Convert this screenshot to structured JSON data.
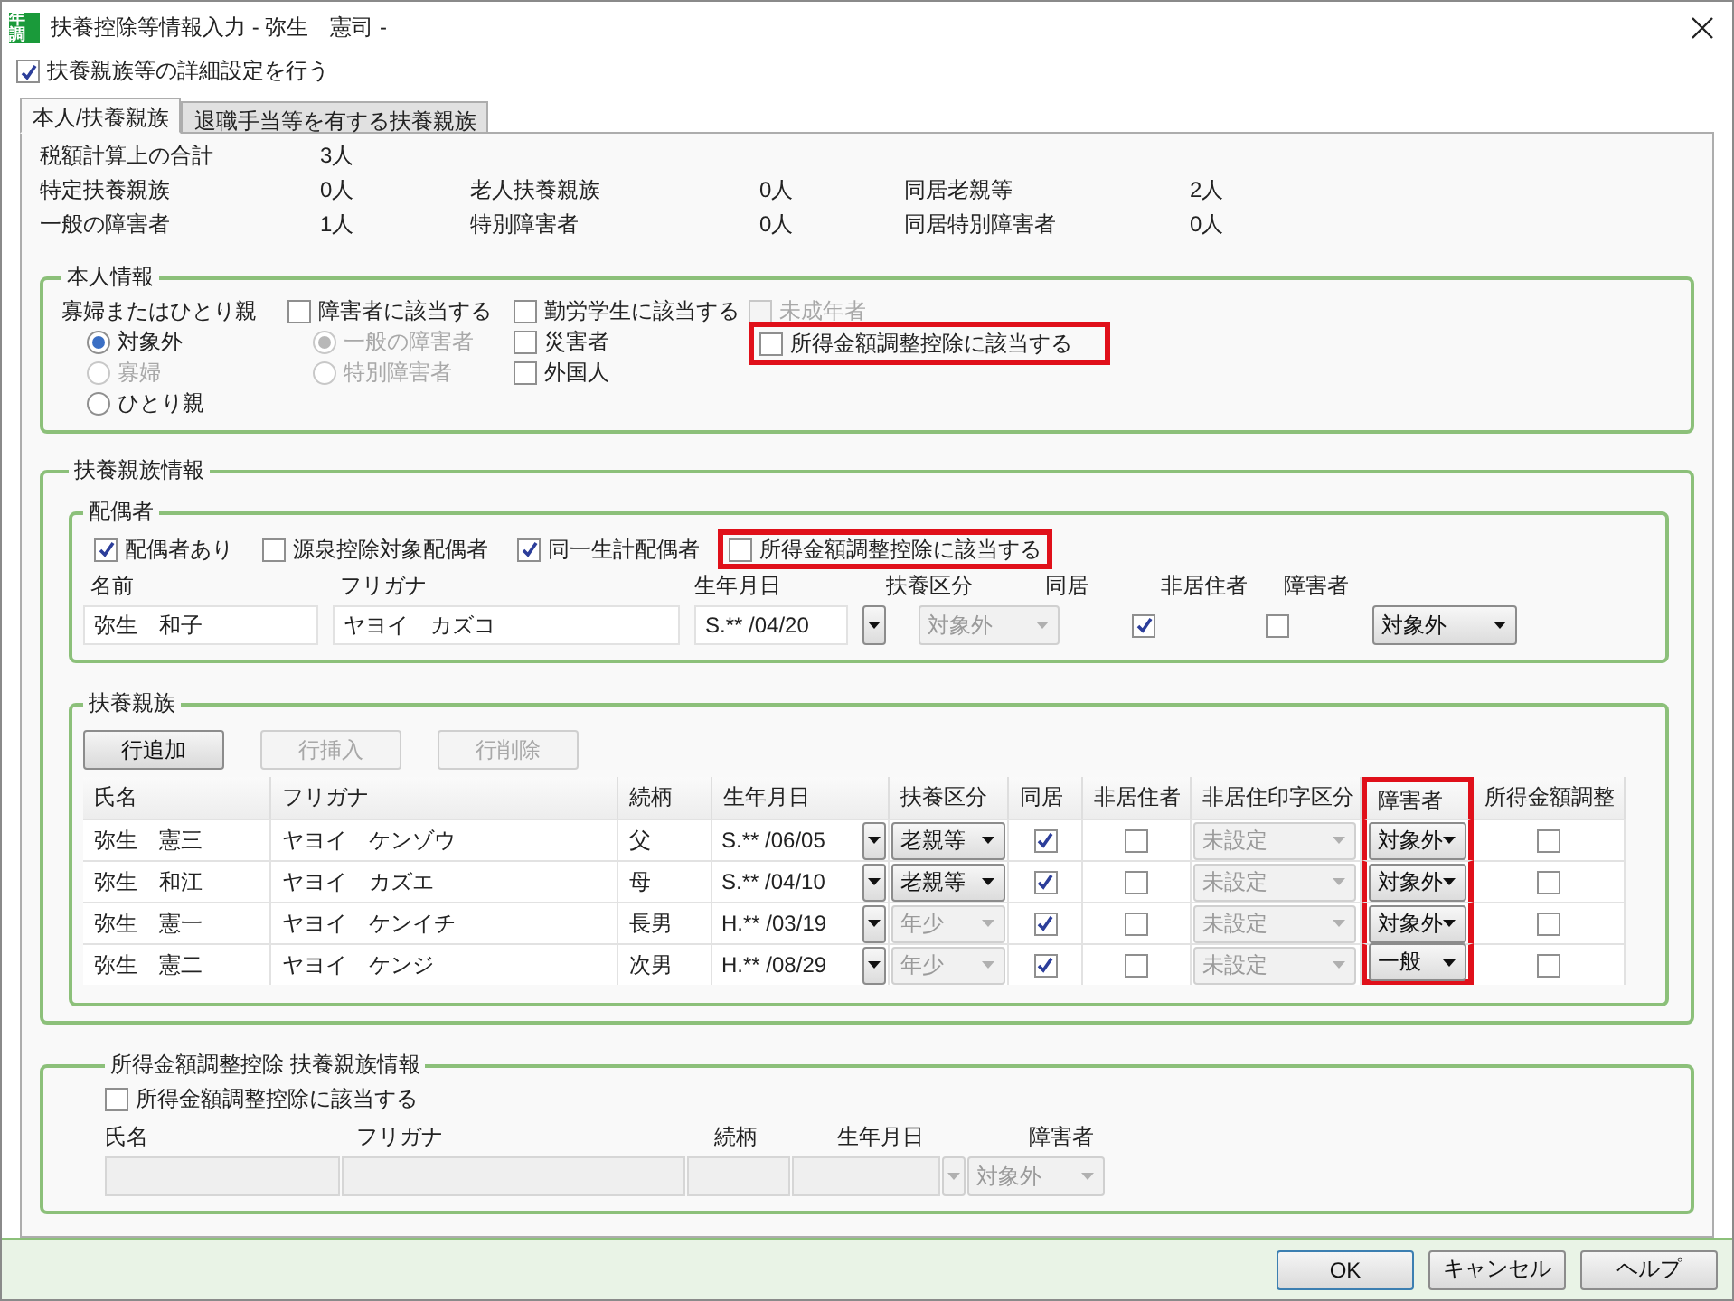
{
  "window": {
    "icon_text": "年調",
    "title": "扶養控除等情報入力 - 弥生　憲司 -"
  },
  "detail_setting": {
    "label": "扶養親族等の詳細設定を行う",
    "checked": true
  },
  "tabs": [
    {
      "label": "本人/扶養親族",
      "selected": true
    },
    {
      "label": "退職手当等を有する扶養親族",
      "selected": false
    }
  ],
  "summary": [
    [
      {
        "label": "税額計算上の合計",
        "value": "3人"
      }
    ],
    [
      {
        "label": "特定扶養親族",
        "value": "0人"
      },
      {
        "label": "老人扶養親族",
        "value": "0人"
      },
      {
        "label": "同居老親等",
        "value": "2人"
      }
    ],
    [
      {
        "label": "一般の障害者",
        "value": "1人"
      },
      {
        "label": "特別障害者",
        "value": "0人"
      },
      {
        "label": "同居特別障害者",
        "value": "0人"
      }
    ]
  ],
  "self_info": {
    "title": "本人情報",
    "widow": {
      "label": "寡婦またはひとり親",
      "options": [
        {
          "label": "対象外",
          "selected": true,
          "disabled": false
        },
        {
          "label": "寡婦",
          "selected": false,
          "disabled": true
        },
        {
          "label": "ひとり親",
          "selected": false,
          "disabled": false
        }
      ]
    },
    "disability": {
      "label": "障害者に該当する",
      "checked": false,
      "options": [
        {
          "label": "一般の障害者",
          "selected": true,
          "disabled": true
        },
        {
          "label": "特別障害者",
          "selected": false,
          "disabled": true
        }
      ]
    },
    "checks": [
      [
        {
          "label": "勤労学生に該当する",
          "checked": false,
          "disabled": false,
          "highlighted": false
        },
        {
          "label": "災害者",
          "checked": false,
          "disabled": false,
          "highlighted": false
        },
        {
          "label": "外国人",
          "checked": false,
          "disabled": false,
          "highlighted": false
        }
      ],
      [
        {
          "label": "未成年者",
          "checked": false,
          "disabled": true,
          "highlighted": false
        },
        {
          "label": "所得金額調整控除に該当する",
          "checked": false,
          "disabled": false,
          "highlighted": true
        }
      ]
    ]
  },
  "dependents_info": {
    "title": "扶養親族情報",
    "spouse": {
      "title": "配偶者",
      "checks": [
        {
          "label": "配偶者あり",
          "checked": true,
          "highlighted": false
        },
        {
          "label": "源泉控除対象配偶者",
          "checked": false,
          "highlighted": false
        },
        {
          "label": "同一生計配偶者",
          "checked": true,
          "highlighted": false
        },
        {
          "label": "所得金額調整控除に該当する",
          "checked": false,
          "highlighted": true
        }
      ],
      "columns": [
        "名前",
        "フリガナ",
        "生年月日",
        "扶養区分",
        "同居",
        "非居住者",
        "障害者"
      ],
      "row": {
        "name": "弥生　和子",
        "kana": "ヤヨイ　カズコ",
        "birth": "S.** /04/20",
        "category": "対象外",
        "category_disabled": true,
        "cohabit": true,
        "nonresident": false,
        "disability": "対象外"
      }
    },
    "family": {
      "title": "扶養親族",
      "buttons": [
        {
          "label": "行追加",
          "disabled": false
        },
        {
          "label": "行挿入",
          "disabled": true
        },
        {
          "label": "行削除",
          "disabled": true
        }
      ],
      "columns": [
        {
          "label": "氏名",
          "highlighted": false
        },
        {
          "label": "フリガナ",
          "highlighted": false
        },
        {
          "label": "続柄",
          "highlighted": false
        },
        {
          "label": "生年月日",
          "highlighted": false
        },
        {
          "label": "扶養区分",
          "highlighted": false
        },
        {
          "label": "同居",
          "highlighted": false
        },
        {
          "label": "非居住者",
          "highlighted": false
        },
        {
          "label": "非居住印字区分",
          "highlighted": false
        },
        {
          "label": "障害者",
          "highlighted": true
        },
        {
          "label": "所得金額調整",
          "highlighted": false
        }
      ],
      "rows": [
        {
          "name": "弥生　憲三",
          "kana": "ヤヨイ　ケンゾウ",
          "relation": "父",
          "birth": "S.** /06/05",
          "category": "老親等",
          "category_disabled": false,
          "cohabit": true,
          "nonresident": false,
          "print_category": "未設定",
          "disability": "対象外",
          "adjustment": false
        },
        {
          "name": "弥生　和江",
          "kana": "ヤヨイ　カズエ",
          "relation": "母",
          "birth": "S.** /04/10",
          "category": "老親等",
          "category_disabled": false,
          "cohabit": true,
          "nonresident": false,
          "print_category": "未設定",
          "disability": "対象外",
          "adjustment": false
        },
        {
          "name": "弥生　憲一",
          "kana": "ヤヨイ　ケンイチ",
          "relation": "長男",
          "birth": "H.** /03/19",
          "category": "年少",
          "category_disabled": true,
          "cohabit": true,
          "nonresident": false,
          "print_category": "未設定",
          "disability": "対象外",
          "adjustment": false
        },
        {
          "name": "弥生　憲二",
          "kana": "ヤヨイ　ケンジ",
          "relation": "次男",
          "birth": "H.** /08/29",
          "category": "年少",
          "category_disabled": true,
          "cohabit": true,
          "nonresident": false,
          "print_category": "未設定",
          "disability": "一般",
          "adjustment": false
        }
      ]
    }
  },
  "adjustment_info": {
    "title": "所得金額調整控除 扶養親族情報",
    "checkbox": {
      "label": "所得金額調整控除に該当する",
      "checked": false
    },
    "columns": [
      "氏名",
      "フリガナ",
      "続柄",
      "生年月日",
      "障害者"
    ],
    "disability": "対象外"
  },
  "buttons": [
    {
      "label": "OK",
      "default": true
    },
    {
      "label": "キャンセル",
      "default": false
    },
    {
      "label": "ヘルプ",
      "default": false
    }
  ]
}
